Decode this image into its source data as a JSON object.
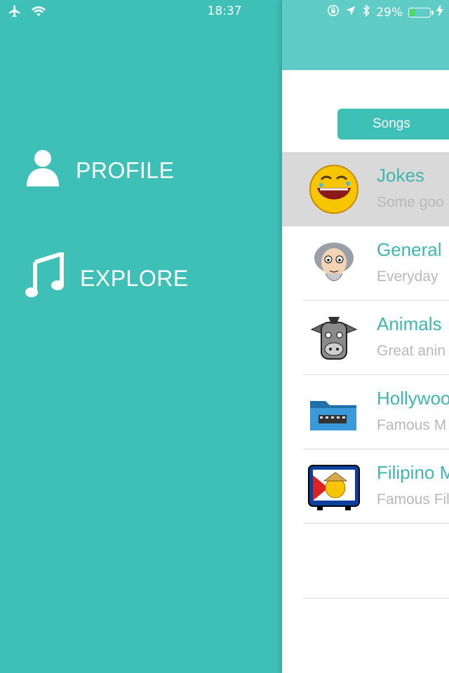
{
  "status_bar": {
    "time": "18:37",
    "battery_percent": "29%",
    "battery_level": 0.29
  },
  "menu": {
    "items": [
      {
        "label": "PROFILE",
        "icon": "person-icon"
      },
      {
        "label": "EXPLORE",
        "icon": "music-note-icon"
      }
    ]
  },
  "panel": {
    "segment_label": "Songs",
    "categories": [
      {
        "title": "Jokes",
        "subtitle": "Some goo",
        "icon": "laughing-face-icon",
        "selected": true
      },
      {
        "title": "General",
        "subtitle": "Everyday",
        "icon": "old-man-icon",
        "selected": false
      },
      {
        "title": "Animals",
        "subtitle": "Great anin",
        "icon": "donkey-icon",
        "selected": false
      },
      {
        "title": "Hollywoo",
        "subtitle": "Famous M",
        "icon": "film-folder-icon",
        "selected": false
      },
      {
        "title": "Filipino M",
        "subtitle": "Famous Fil",
        "icon": "filipino-tv-icon",
        "selected": false
      }
    ]
  },
  "colors": {
    "teal": "#3fc0b7",
    "title_teal": "#3fb7ae",
    "selected_row": "#d9d9d9"
  }
}
